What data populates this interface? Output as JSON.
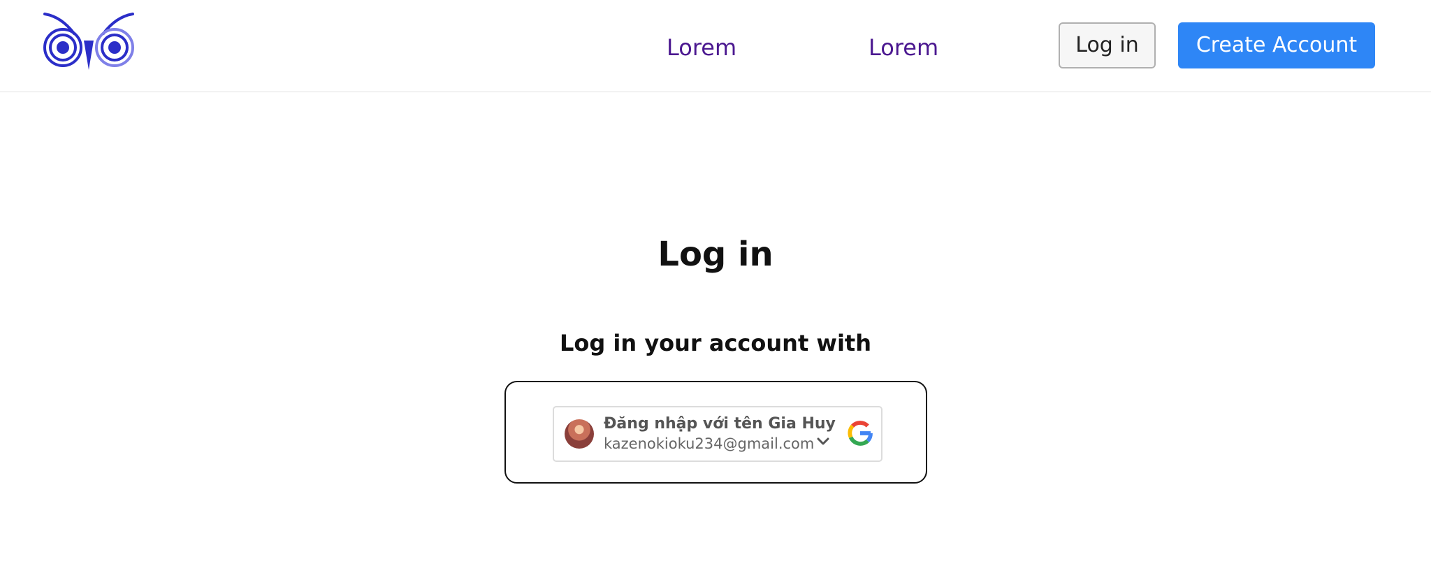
{
  "header": {
    "logo_icon": "owl-logo-icon",
    "nav": [
      {
        "label": "Lorem"
      },
      {
        "label": "Lorem"
      }
    ],
    "login_label": "Log in",
    "create_label": "Create Account",
    "accent": "#2e86f6",
    "link_color": "#4b1890"
  },
  "main": {
    "title": "Log in",
    "subtitle": "Log in your account with",
    "google": {
      "account_name": "Đăng nhập với tên Gia Huy",
      "email": "kazenokioku234@gmail.com",
      "icon": "google-icon",
      "chevron_icon": "chevron-down-icon",
      "avatar_icon": "avatar"
    }
  }
}
